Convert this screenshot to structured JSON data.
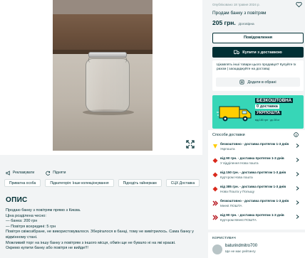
{
  "listing": {
    "posted": "Опубліковано 18 травня 2024 р.",
    "title": "Продам банку з повітрям",
    "price": "205 грн.",
    "negotiable": "Договірна"
  },
  "buttons": {
    "message": "Повідомлення",
    "buy_delivery": "Купити з доставкою"
  },
  "promo": {
    "text": "Цікавлять інші товари цього продавця? Купуйте їх разом | заощаджуйте на доставці",
    "add_fav": "Додати в обрані"
  },
  "ad": {
    "line1": "БЕЗКОШТОВНА",
    "line2_prefix": "0",
    "line2_suffix": "доставка",
    "line3": "УКРПОШТА",
    "line4": "від 180 грн · до 28 кг"
  },
  "delivery": {
    "title": "Способи доставки",
    "options": [
      {
        "line1": "безкоштовно - доставка протягом 1-3 днів",
        "line2": "Укрпошта",
        "logo_color": "#ffcc00"
      },
      {
        "line1": "від 90 грн. - доставка протягом 1-3 днів",
        "line2": "У відділення Нова пошта",
        "logo_color": "#da291c"
      },
      {
        "line1": "від 150 грн. - доставка протягом 1-3 днів",
        "line2": "Кур'єром Нова пошта",
        "logo_color": "#da291c"
      },
      {
        "line1": "від 385 грн. - доставка протягом 1-3 днів",
        "line2": "Нова Пошта у Польщу",
        "logo_color": "#da291c"
      },
      {
        "line1": "безкоштовно - доставка протягом 1-3 днів",
        "line2": "Meest ПОШТА",
        "logo_color": "#b5121b"
      },
      {
        "line1": "від 90 грн. - доставка протягом 1-3 днів",
        "line2": "Кур'єром Meest ПОШТА",
        "logo_color": "#b5121b"
      }
    ]
  },
  "user": {
    "label": "КОРИСТУВАЧ",
    "name": "baturindmitro700",
    "since": "Ще не має рейтингу"
  },
  "actions": {
    "promote": "Рекламувати",
    "refresh": "Підняти"
  },
  "tags": [
    "Приватна особа",
    "Підкатегорія: Інше колекціонування",
    "Підходіть гайнеркам",
    "СЦХ Доставка"
  ],
  "section_title": "ОПИС",
  "description": [
    "Продаю банку з повітрям прямо з Києва.",
    "Ціна розділена чесно:",
    "— банка: 200 грн",
    "— Повітря всередині: 5 грн",
    "Повітря свіжозібране, не використовувалося. Зберігалося в банці, тому не вивітрилось. Сама банку у",
    "відмінному стані.",
    "Можливий торг на іншу банку з повітрям з іншого місця, обмін ще не бувало ні на які краєві.",
    "Окремо купити банку або повітря не вийде!!!"
  ],
  "colors": {
    "brand": "#002f34",
    "accent": "#37d6b7",
    "background": "#f2f4f5"
  }
}
